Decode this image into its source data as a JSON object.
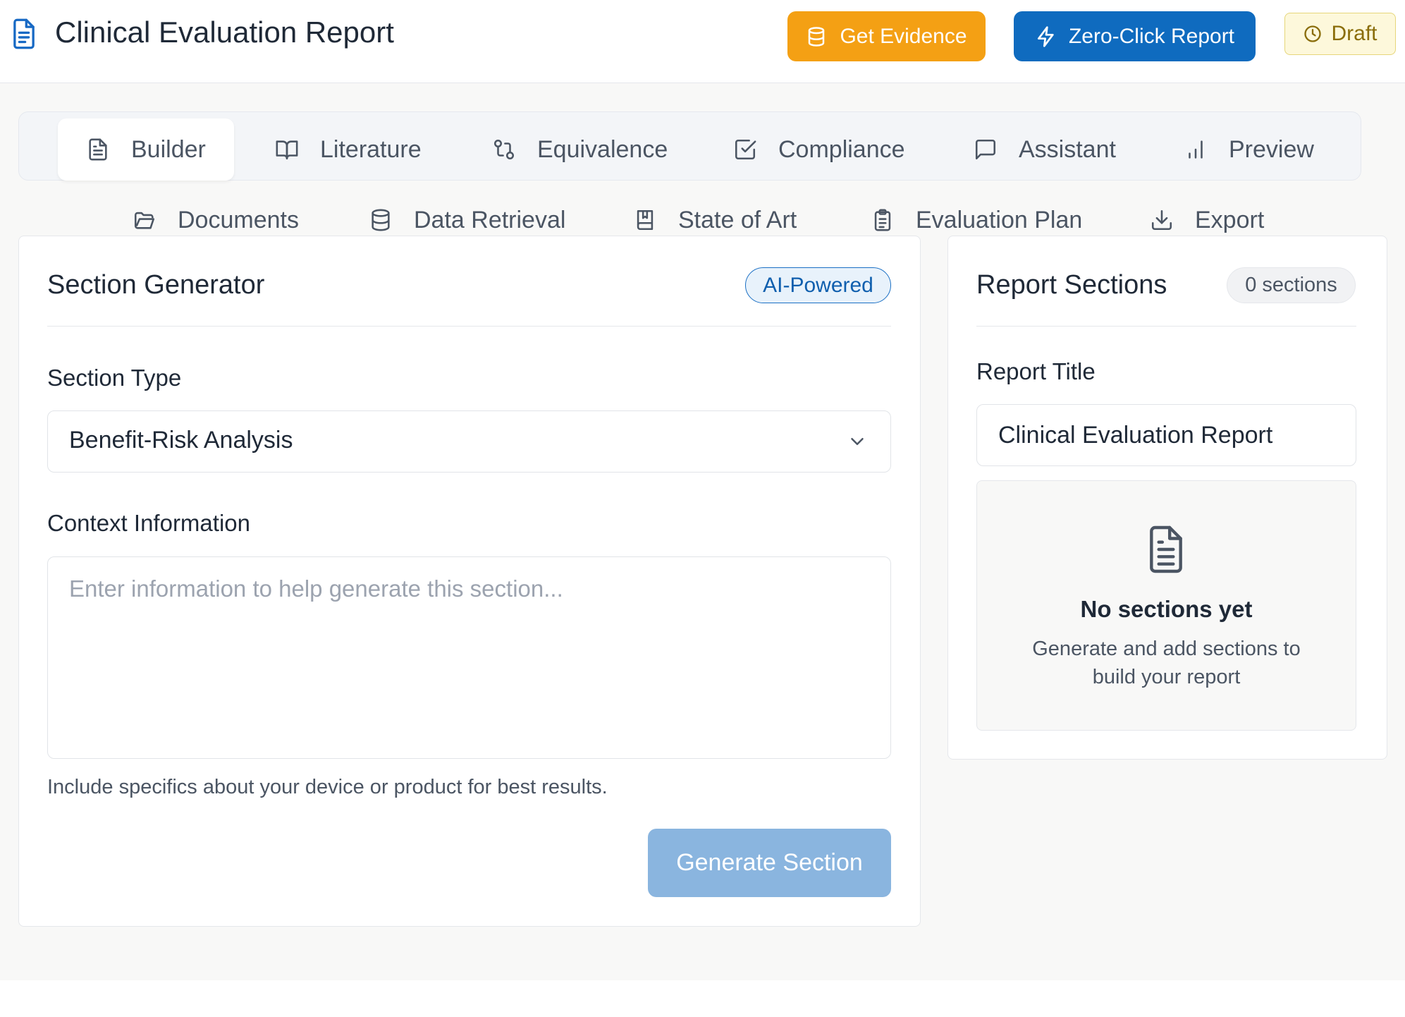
{
  "header": {
    "title": "Clinical Evaluation Report",
    "get_evidence_label": "Get Evidence",
    "zero_click_label": "Zero-Click Report",
    "status_label": "Draft"
  },
  "tabs": {
    "row1": [
      {
        "label": "Builder",
        "icon": "file-text-icon",
        "active": true
      },
      {
        "label": "Literature",
        "icon": "book-open-icon"
      },
      {
        "label": "Equivalence",
        "icon": "git-compare-icon"
      },
      {
        "label": "Compliance",
        "icon": "check-square-icon"
      },
      {
        "label": "Assistant",
        "icon": "message-square-icon"
      },
      {
        "label": "Preview",
        "icon": "bar-chart-icon"
      }
    ],
    "row2": [
      {
        "label": "Documents",
        "icon": "folder-open-icon"
      },
      {
        "label": "Data Retrieval",
        "icon": "database-icon"
      },
      {
        "label": "State of Art",
        "icon": "bookmark-book-icon"
      },
      {
        "label": "Evaluation Plan",
        "icon": "clipboard-list-icon"
      },
      {
        "label": "Export",
        "icon": "download-icon"
      }
    ]
  },
  "generator": {
    "title": "Section Generator",
    "badge": "AI-Powered",
    "section_type_label": "Section Type",
    "section_type_value": "Benefit-Risk Analysis",
    "context_label": "Context Information",
    "context_placeholder": "Enter information to help generate this section...",
    "hint": "Include specifics about your device or product for best results.",
    "generate_label": "Generate Section"
  },
  "report": {
    "title": "Report Sections",
    "count_badge": "0 sections",
    "report_title_label": "Report Title",
    "report_title_value": "Clinical Evaluation Report",
    "empty_title": "No sections yet",
    "empty_desc": "Generate and add sections to build your report"
  },
  "colors": {
    "primary": "#0f6bbf",
    "evidence": "#f4a014",
    "draft_bg": "#fdf8db",
    "generate_disabled": "#8ab5df"
  }
}
